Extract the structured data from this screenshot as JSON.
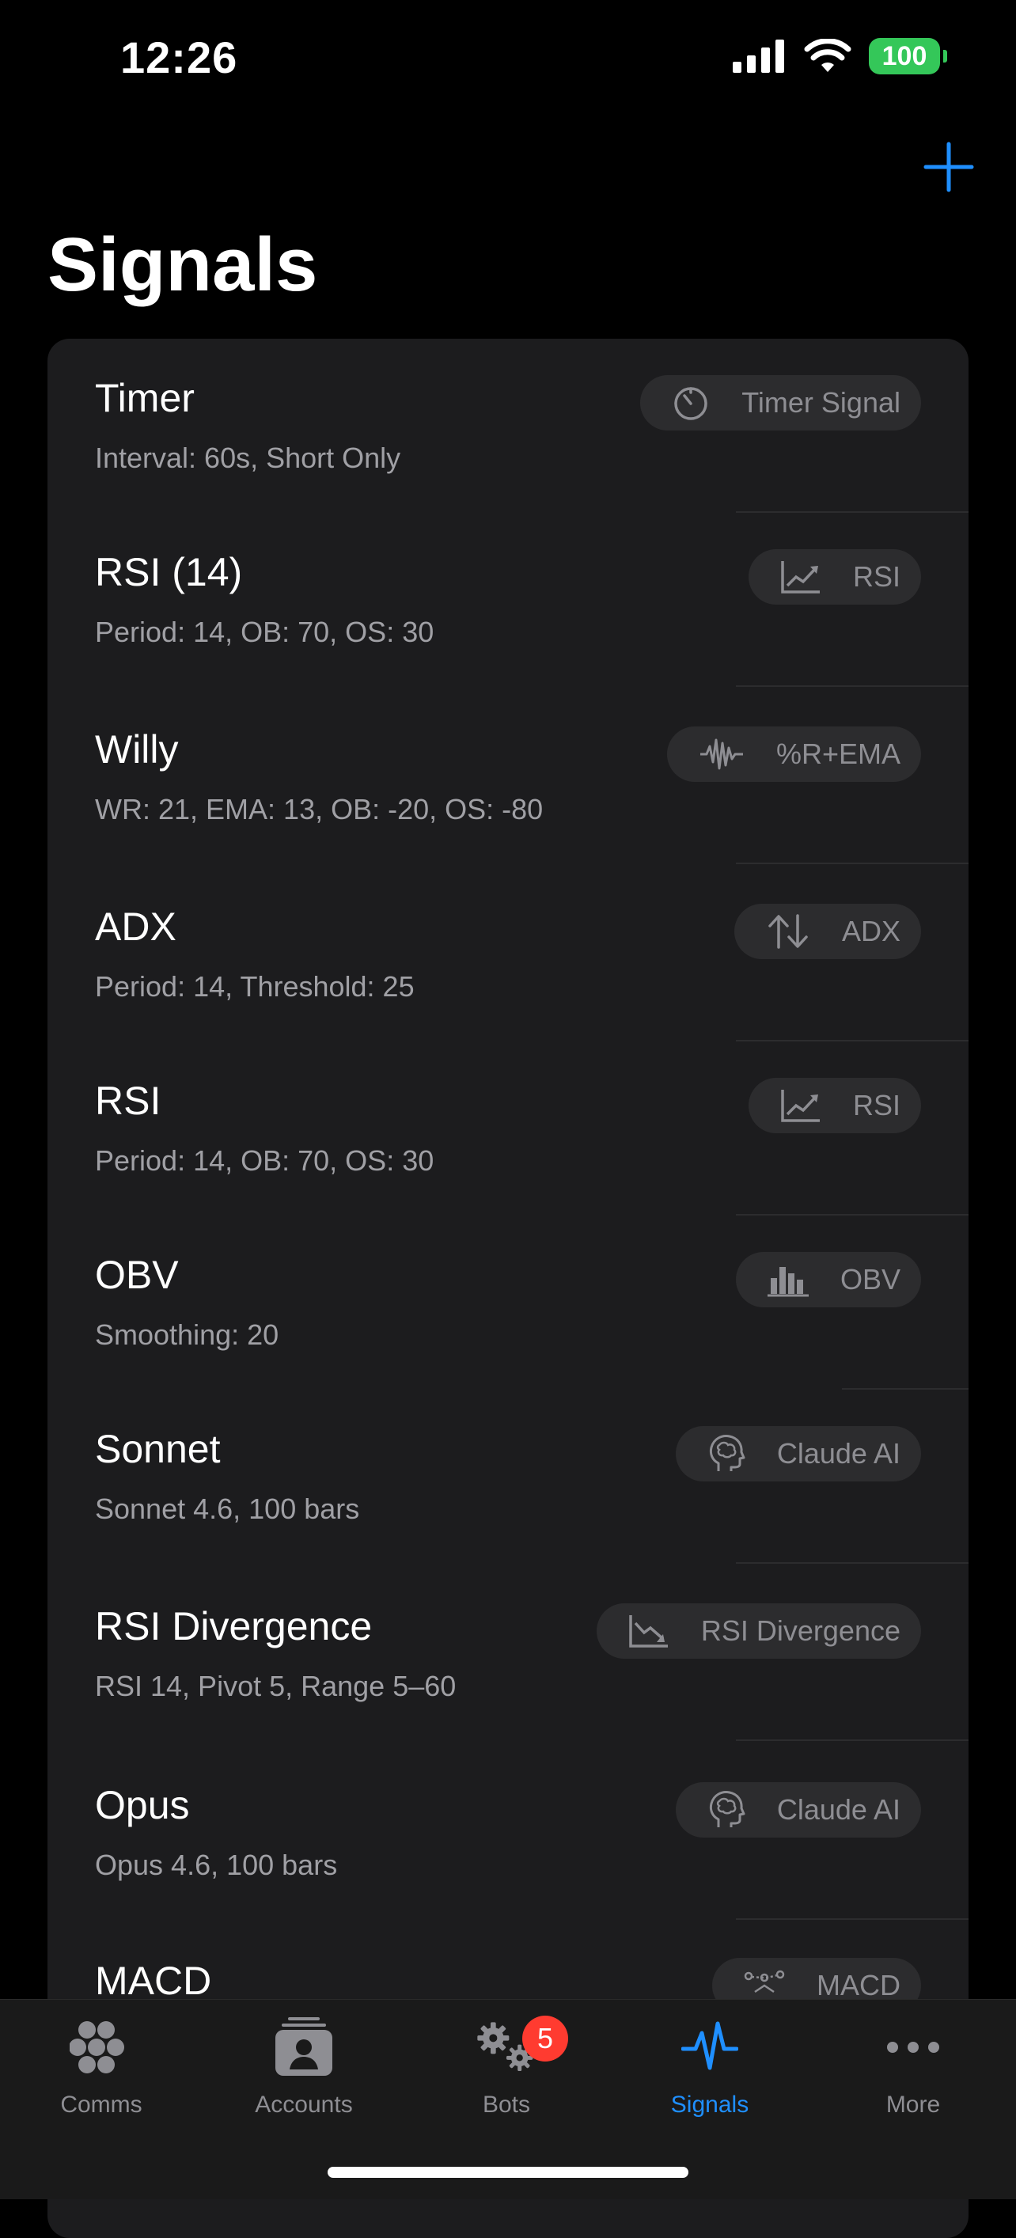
{
  "status": {
    "time": "12:26",
    "battery": "100"
  },
  "page": {
    "title": "Signals"
  },
  "signals": [
    {
      "name": "Timer",
      "detail": "Interval: 60s, Short Only",
      "type": "Timer Signal",
      "icon": "timer-icon"
    },
    {
      "name": "RSI (14)",
      "detail": "Period: 14, OB: 70, OS: 30",
      "type": "RSI",
      "icon": "chart-up-icon"
    },
    {
      "name": "Willy",
      "detail": "WR: 21, EMA: 13, OB: -20, OS: -80",
      "type": "%R+EMA",
      "icon": "waveform-icon"
    },
    {
      "name": "ADX",
      "detail": "Period: 14, Threshold: 25",
      "type": "ADX",
      "icon": "arrows-up-down-icon"
    },
    {
      "name": "RSI",
      "detail": "Period: 14, OB: 70, OS: 30",
      "type": "RSI",
      "icon": "chart-up-icon"
    },
    {
      "name": "OBV",
      "detail": "Smoothing: 20",
      "type": "OBV",
      "icon": "bars-icon"
    },
    {
      "name": "Sonnet",
      "detail": "Sonnet 4.6, 100 bars",
      "type": "Claude AI",
      "icon": "brain-head-icon"
    },
    {
      "name": "RSI Divergence",
      "detail": "RSI 14, Pivot 5, Range 5–60",
      "type": "RSI Divergence",
      "icon": "chart-down-icon"
    },
    {
      "name": "Opus",
      "detail": "Opus 4.6, 100 bars",
      "type": "Claude AI",
      "icon": "brain-head-icon"
    },
    {
      "name": "MACD",
      "detail": "",
      "type": "MACD",
      "icon": "macd-icon"
    }
  ],
  "tabs": [
    {
      "label": "Comms",
      "icon": "comms-icon",
      "active": false
    },
    {
      "label": "Accounts",
      "icon": "accounts-icon",
      "active": false
    },
    {
      "label": "Bots",
      "icon": "gears-icon",
      "active": false,
      "badge": "5"
    },
    {
      "label": "Signals",
      "icon": "waveform-icon",
      "active": true
    },
    {
      "label": "More",
      "icon": "more-icon",
      "active": false
    }
  ],
  "colors": {
    "accent": "#1f8fff",
    "badge": "#ff3b30",
    "battery": "#34c759",
    "card": "#1c1c1e",
    "pill": "#2c2c2e"
  }
}
